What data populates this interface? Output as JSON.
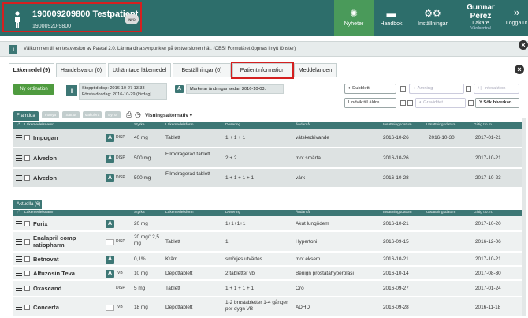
{
  "header": {
    "patient_id_name": "190009209800 Testpatient",
    "patient_number": "19000920-9800",
    "patient_badge": "INFO",
    "nyheter": "Nyheter",
    "handbok": "Handbok",
    "installningar": "Inställningar",
    "user_name": "Gunnar Perez",
    "user_role": "Läkare",
    "user_org": "Vårdcentral",
    "logout": "Logga ut"
  },
  "infobar": {
    "text": "Välkommen till en testversion av Pascal 2.0. Lämna dina synpunkter på testversionen här. (OBS! Formuläret öppnas i nytt fönster)"
  },
  "tabs": [
    {
      "label": "Läkemedel (9)"
    },
    {
      "label": "Handelsvaror (0)"
    },
    {
      "label": "Uthämtade läkemedel"
    },
    {
      "label": "Beställningar (0)"
    },
    {
      "label": "Patientinformation"
    },
    {
      "label": "Meddelanden"
    }
  ],
  "toolbar": {
    "ny_ordination": "Ny ordination",
    "stop_line1": "Stopptid disp: 2016-10-27 13:33",
    "stop_line2": "Första dosdag: 2016-10-29 (lördag).",
    "mark_text": "Markerar ändringar sedan 2016-10-03.",
    "dubblett": "Dubblett",
    "amning": "Amning",
    "interaktion": "Interaktion",
    "undvik": "Undvik till äldre",
    "graviditet": "Graviditet",
    "sok_biverkan": "Sök biverkan"
  },
  "framtida": {
    "tab": "Framtida (3)",
    "pills": [
      "Förnya",
      "Sätt ut",
      "Makulera",
      "Byt ut"
    ],
    "visningsalternativ": "Visningsalternativ",
    "columns": [
      "Läkemedelsnamn",
      "Styrka",
      "Läkemedelsform",
      "Dosering",
      "Ändamål",
      "Insättningsdatum",
      "Utsättningsdatum",
      "Giltig t.o.m."
    ],
    "rows": [
      {
        "name": "Impugan",
        "badge": "A",
        "disp": "DISP",
        "styrka": "40 mg",
        "form": "Tablett",
        "dosering": "1 + 1 + 1",
        "andamal": "vätskedrivande",
        "ins": "2016-10-26",
        "uts": "2016-10-30",
        "giltig": "2017-01-21"
      },
      {
        "name": "Alvedon",
        "badge": "A",
        "disp": "DISP",
        "styrka": "500 mg",
        "form": "Filmdragerad tablett",
        "dosering": "2 + 2",
        "andamal": "mot smärta",
        "ins": "2016-10-26",
        "uts": "",
        "giltig": "2017-10-21"
      },
      {
        "name": "Alvedon",
        "badge": "A",
        "disp": "DISP",
        "styrka": "500 mg",
        "form": "Filmdragerad tablett",
        "dosering": "1 + 1 + 1 + 1",
        "andamal": "värk",
        "ins": "2016-10-28",
        "uts": "",
        "giltig": "2017-10-23"
      }
    ]
  },
  "aktuella": {
    "tab": "Aktuella (6)",
    "columns": [
      "Läkemedelsnamn",
      "Styrka",
      "Läkemedelsform",
      "Dosering",
      "Ändamål",
      "Insättningsdatum",
      "Utsättningsdatum",
      "Giltig t.o.m."
    ],
    "rows": [
      {
        "name": "Furix",
        "badge": "A",
        "disp": "",
        "styrka": "20 mg",
        "form": "",
        "dosering": "1+1+1+1",
        "andamal": "Akut lungödem",
        "ins": "2016-10-21",
        "uts": "",
        "giltig": "2017-10-20"
      },
      {
        "name": "Enalapril comp ratiopharm",
        "badge": "",
        "disp": "DISP",
        "styrka": "20 mg/12,5 mg",
        "form": "Tablett",
        "dosering": "1",
        "andamal": "Hypertoni",
        "ins": "2016-09-15",
        "uts": "",
        "giltig": "2016-12-06"
      },
      {
        "name": "Betnovat",
        "badge": "A",
        "disp": "",
        "styrka": "0,1%",
        "form": "Kräm",
        "dosering": "smörjes utvärtes",
        "andamal": "mot eksem",
        "ins": "2016-10-21",
        "uts": "",
        "giltig": "2017-10-21"
      },
      {
        "name": "Alfuzosin Teva",
        "badge": "A",
        "disp": "VB",
        "styrka": "10 mg",
        "form": "Depottablett",
        "dosering": "2 tabletter vb",
        "andamal": "Benign prostatahyperplasi",
        "ins": "2016-10-14",
        "uts": "",
        "giltig": "2017-08-30"
      },
      {
        "name": "Oxascand",
        "badge": "",
        "disp": "DISP",
        "styrka": "5 mg",
        "form": "Tablett",
        "dosering": "1 + 1 + 1 + 1",
        "andamal": "Oro",
        "ins": "2016-09-27",
        "uts": "",
        "giltig": "2017-01-24"
      },
      {
        "name": "Concerta",
        "badge": "",
        "disp": "VB",
        "styrka": "18 mg",
        "form": "Depottablett",
        "dosering": "1-2 brustabletter 1-4 gånger per dygn VB",
        "andamal": "ADHD",
        "ins": "2016-09-28",
        "uts": "",
        "giltig": "2016-11-18"
      }
    ]
  }
}
